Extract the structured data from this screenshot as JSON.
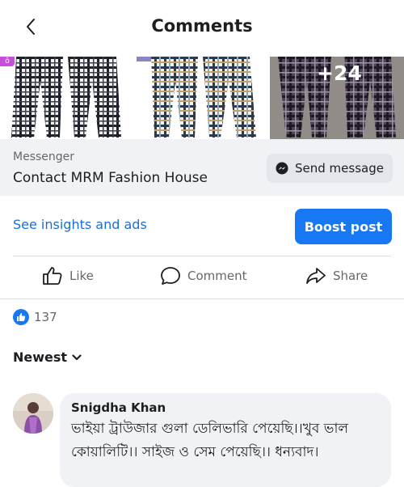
{
  "header": {
    "title": "Comments"
  },
  "images": {
    "more_count": "+24",
    "tag_text": "ô"
  },
  "messenger": {
    "label": "Messenger",
    "title": "Contact MRM Fashion House",
    "button_label": "Send message"
  },
  "insights": {
    "link_label": "See insights and ads",
    "boost_label": "Boost post"
  },
  "actions": {
    "like_label": "Like",
    "comment_label": "Comment",
    "share_label": "Share"
  },
  "reactions": {
    "count": "137"
  },
  "sort": {
    "label": "Newest"
  },
  "comments": [
    {
      "author": "Snigdha Khan",
      "text": "ভাইয়া ট্রাউজার গুলা ডেলিভারি পেয়েছি।।খুব ভাল কোয়ালিটি।। সাইজ ও সেম পেয়েছি।। ধন্যবাদ।"
    }
  ],
  "colors": {
    "accent": "#1877f2",
    "link": "#1a6ed8",
    "muted": "#65676b",
    "panel": "#f0f2f5"
  },
  "icons": [
    "back-arrow-icon",
    "messenger-icon",
    "thumbs-up-icon",
    "comment-bubble-icon",
    "share-arrow-icon",
    "like-reaction-icon",
    "chevron-down-icon"
  ]
}
